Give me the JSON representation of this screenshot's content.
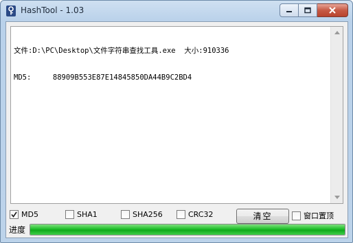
{
  "window": {
    "title": "HashTool - 1.03",
    "caption_buttons": [
      "minimize-icon",
      "maximize-icon",
      "close-icon"
    ]
  },
  "output": {
    "lines": [
      "文件:D:\\PC\\Desktop\\文件字符串查找工具.exe  大小:910336",
      "MD5:     88909B553E87E14845850DA44B9C2BD4"
    ]
  },
  "options": {
    "md5": {
      "label": "MD5",
      "checked": true
    },
    "sha1": {
      "label": "SHA1",
      "checked": false
    },
    "sha256": {
      "label": "SHA256",
      "checked": false
    },
    "crc32": {
      "label": "CRC32",
      "checked": false
    },
    "clear_label": "清空",
    "topmost": {
      "label": "窗口置顶",
      "checked": false
    }
  },
  "progress": {
    "label": "进度",
    "fraction": 1.0,
    "color": "#1fbf2a"
  }
}
